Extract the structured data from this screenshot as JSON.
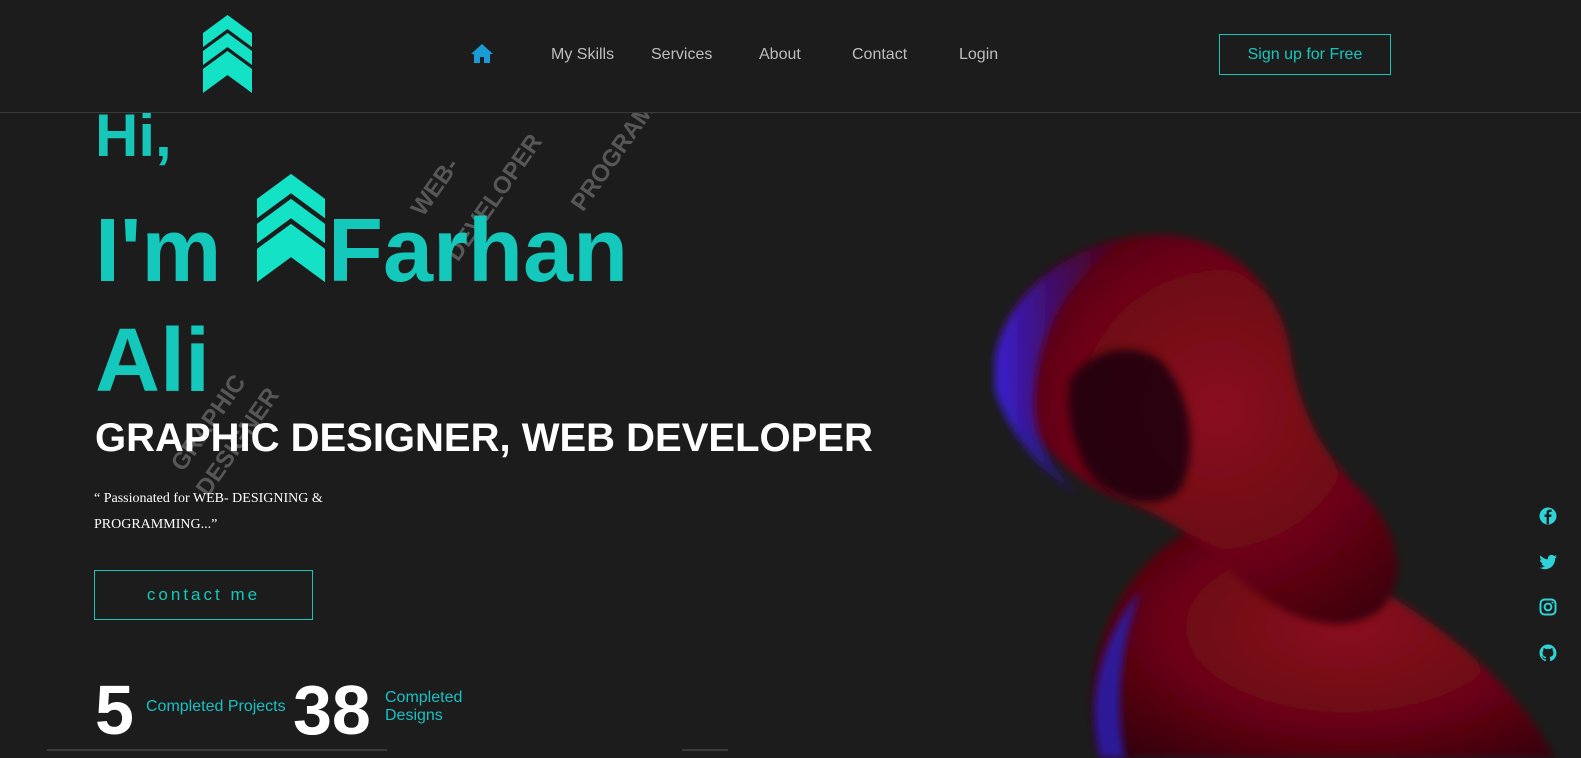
{
  "nav": {
    "home_icon": "home-icon",
    "links": [
      {
        "label": "My Skills"
      },
      {
        "label": "Services"
      },
      {
        "label": "About"
      },
      {
        "label": "Contact"
      },
      {
        "label": "Login"
      }
    ],
    "signup_label": "Sign up for Free"
  },
  "hero": {
    "greeting": "Hi,",
    "name_prefix": "I'm",
    "name_first": "Farhan",
    "name_last": "Ali",
    "role": "GRAPHIC DESIGNER, WEB DEVELOPER",
    "quote_line1": "“ Passionated for WEB- DESIGNING &",
    "quote_line2": "PROGRAMMING...”",
    "contact_label": "contact me"
  },
  "watermarks": {
    "web_a": "WEB-",
    "web_b": "DEVELOPER",
    "prog": "PROGRAMMER",
    "graph_a": "GRAPHIC",
    "graph_b": "DESIGNER"
  },
  "stats": [
    {
      "number": "5",
      "label": "Completed Projects"
    },
    {
      "number": "38",
      "label_line1": "Completed",
      "label_line2": "Designs"
    }
  ],
  "social": [
    "facebook-icon",
    "twitter-icon",
    "instagram-icon",
    "github-icon"
  ],
  "colors": {
    "accent": "#14c8bb",
    "background": "#1c1c1c",
    "nav_text": "#bdbdbd",
    "home_icon": "#1b9bd6",
    "social": "#2ed3d8"
  }
}
